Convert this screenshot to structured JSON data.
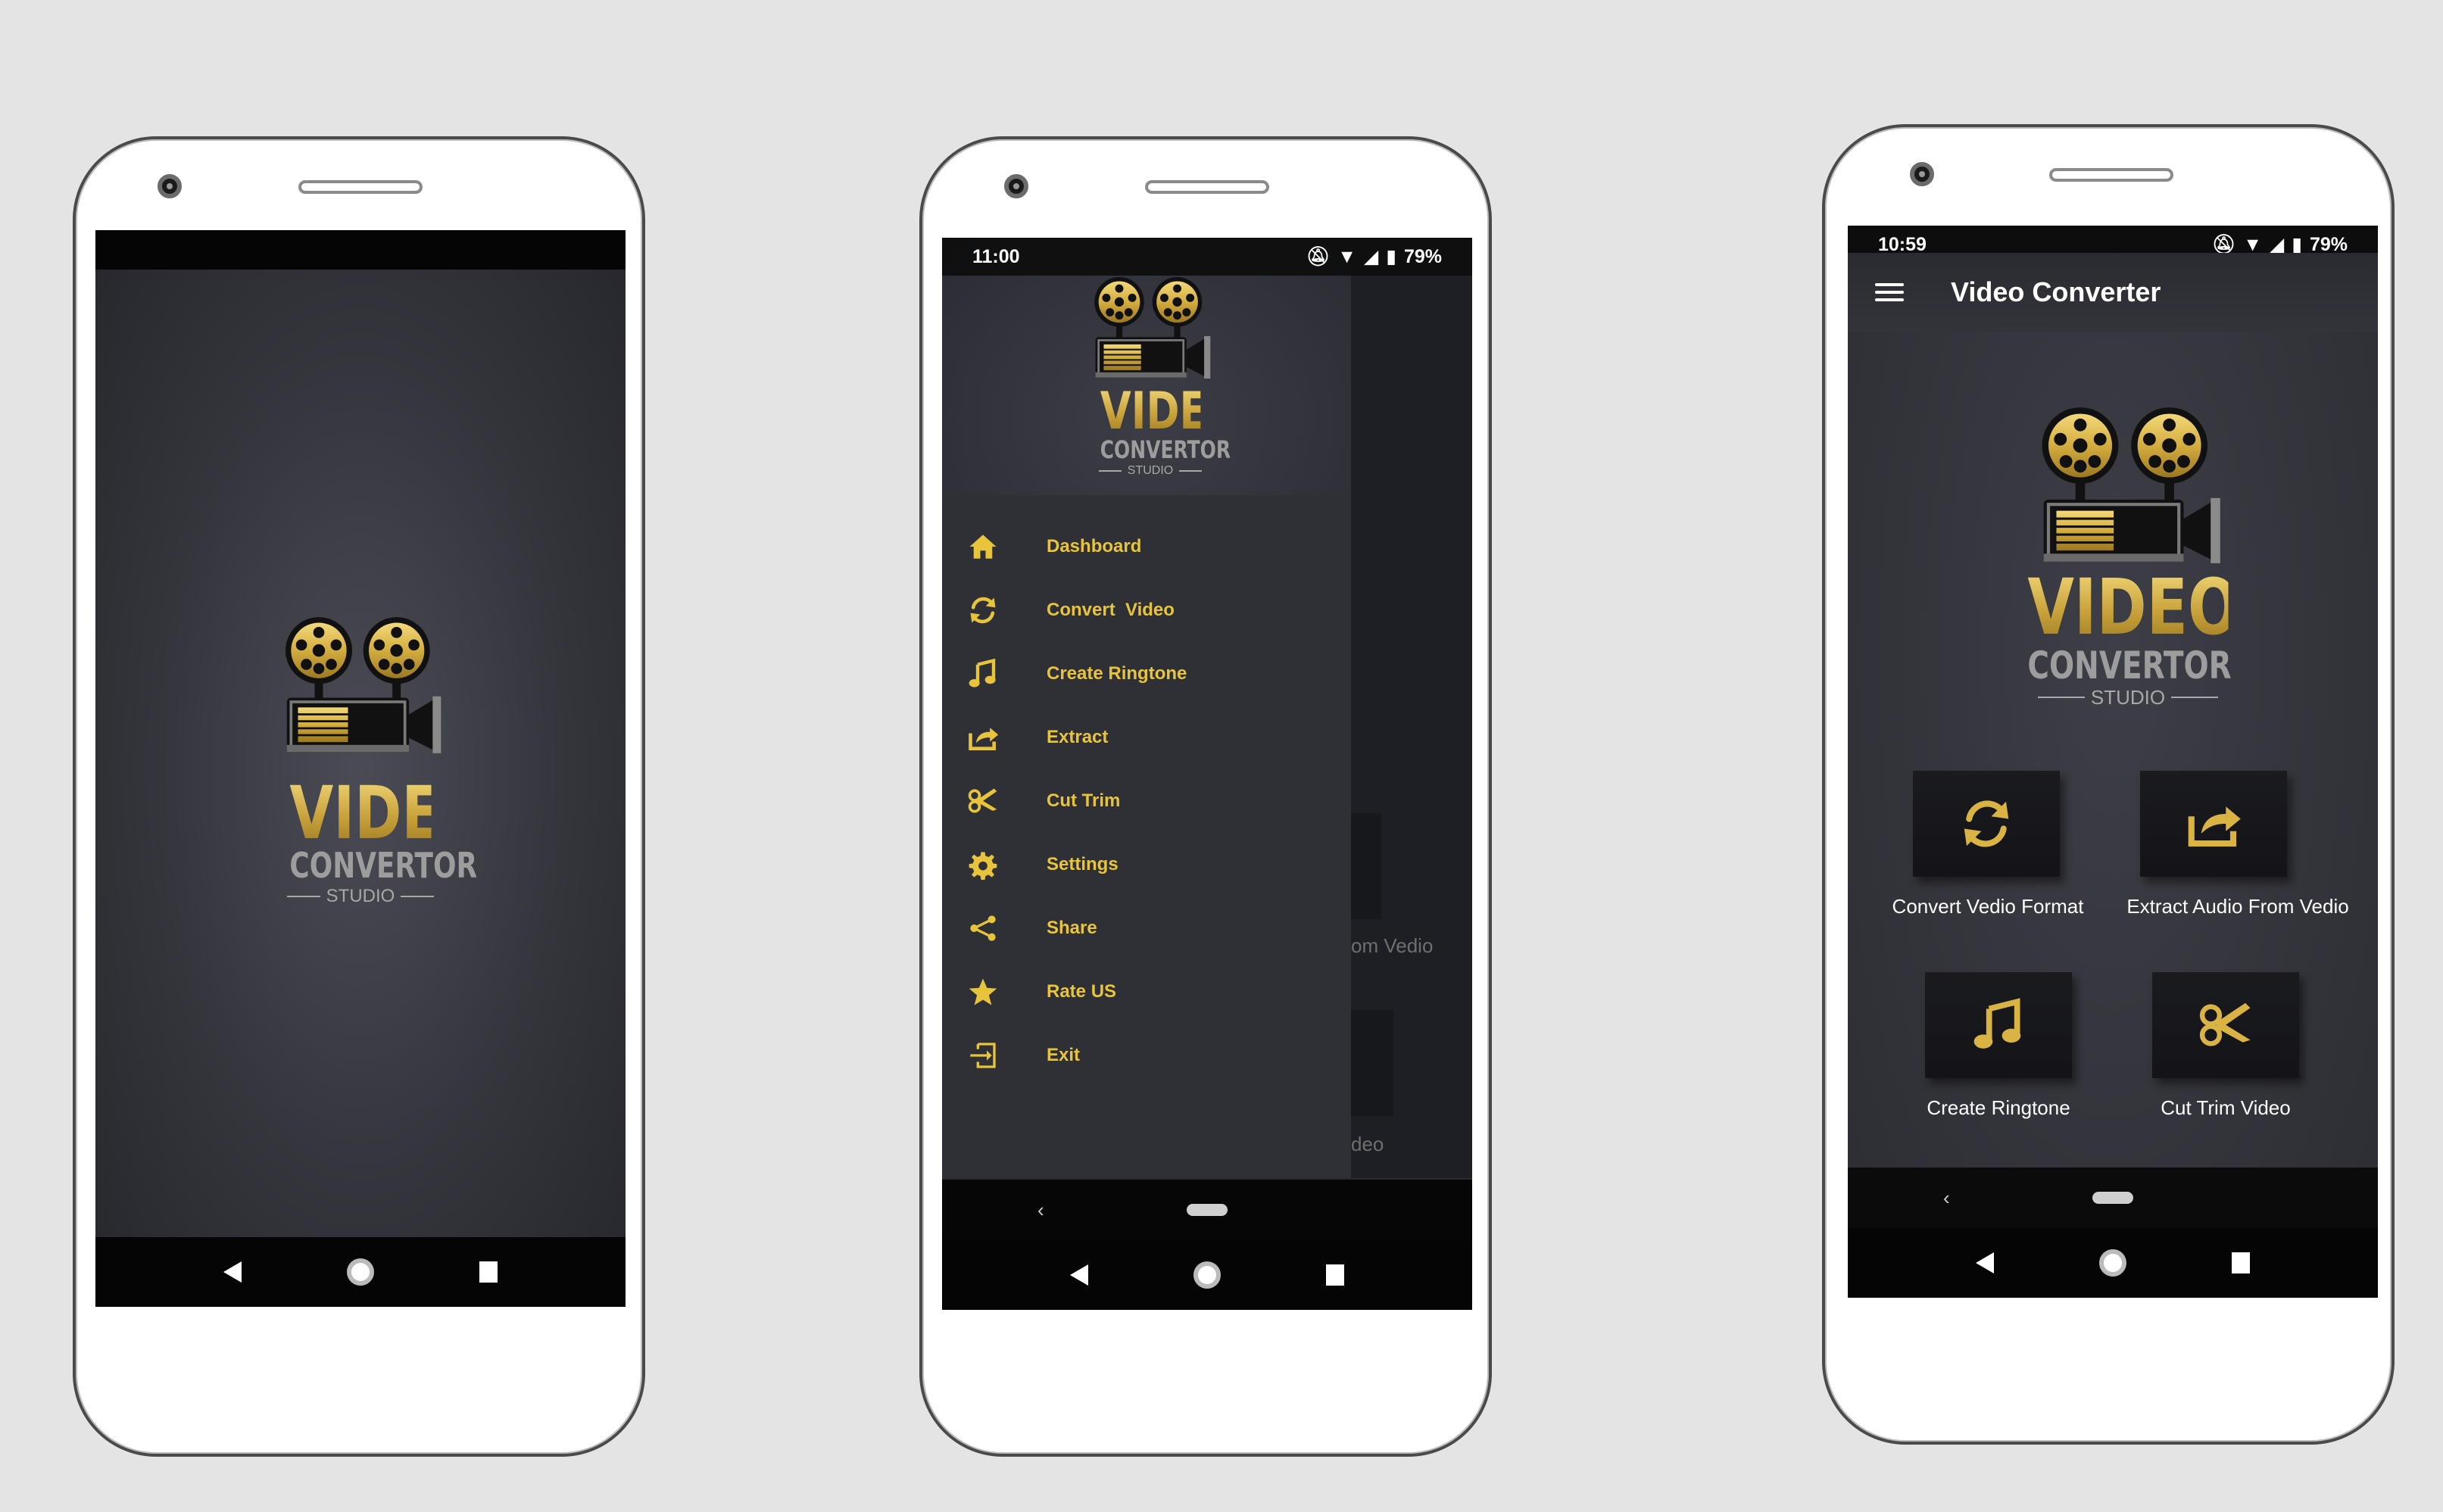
{
  "colors": {
    "accent_gold": "#e8c43d",
    "screen_bg": "#34353c",
    "status_bar": "#0d0d0d",
    "drawer_bg": "#2f3036"
  },
  "logo": {
    "word1": "VIDEO",
    "word2": "CONVERTOR",
    "word3": "STUDIO",
    "icon": "film-projector-icon"
  },
  "phone1": {
    "screen": "splash"
  },
  "phone2": {
    "status": {
      "time": "11:00",
      "battery": "79%"
    },
    "menu": [
      {
        "label": "Dashboard",
        "icon": "home-icon"
      },
      {
        "label": "Convert  Video",
        "icon": "refresh-icon"
      },
      {
        "label": "Create Ringtone",
        "icon": "music-note-icon"
      },
      {
        "label": "Extract",
        "icon": "share-arrow-icon"
      },
      {
        "label": "Cut Trim",
        "icon": "scissors-icon"
      },
      {
        "label": "Settings",
        "icon": "gear-icon"
      },
      {
        "label": "Share",
        "icon": "share-icon"
      },
      {
        "label": "Rate US",
        "icon": "star-icon"
      },
      {
        "label": "Exit",
        "icon": "exit-icon"
      }
    ],
    "behind": {
      "text1": "om Vedio",
      "text2": "deo"
    }
  },
  "phone3": {
    "status": {
      "time": "10:59",
      "battery": "79%"
    },
    "title": "Video Converter",
    "tiles": [
      {
        "label": "Convert Vedio Format",
        "icon": "refresh-icon"
      },
      {
        "label": "Extract Audio From Vedio",
        "icon": "share-arrow-icon"
      },
      {
        "label": "Create Ringtone",
        "icon": "music-note-icon"
      },
      {
        "label": "Cut Trim Video",
        "icon": "scissors-icon"
      }
    ]
  }
}
